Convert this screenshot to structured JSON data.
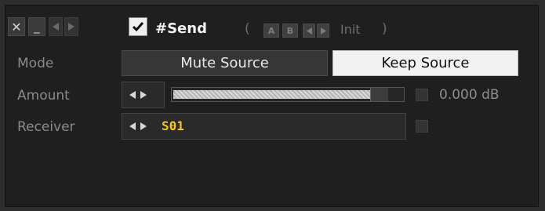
{
  "header": {
    "close_glyph": "✕",
    "minimize_glyph": "_",
    "title": "#Send",
    "paren_open": "(",
    "paren_close": ")",
    "preset_a": "A",
    "preset_b": "B",
    "preset_name": "Init",
    "enabled": true
  },
  "rows": {
    "mode": {
      "label": "Mode",
      "options": [
        "Mute Source",
        "Keep Source"
      ],
      "selected": "Keep Source"
    },
    "amount": {
      "label": "Amount",
      "value_text": "0.000 dB",
      "fill_fraction": 0.93
    },
    "receiver": {
      "label": "Receiver",
      "value": "S01"
    }
  },
  "colors": {
    "accent_receiver": "#f5c518",
    "panel_bg": "#1f1f1f"
  },
  "icons": {
    "close": "close-icon",
    "minimize": "minimize-icon",
    "prev": "arrow-left-icon",
    "next": "arrow-right-icon",
    "check": "checkmark-icon"
  }
}
